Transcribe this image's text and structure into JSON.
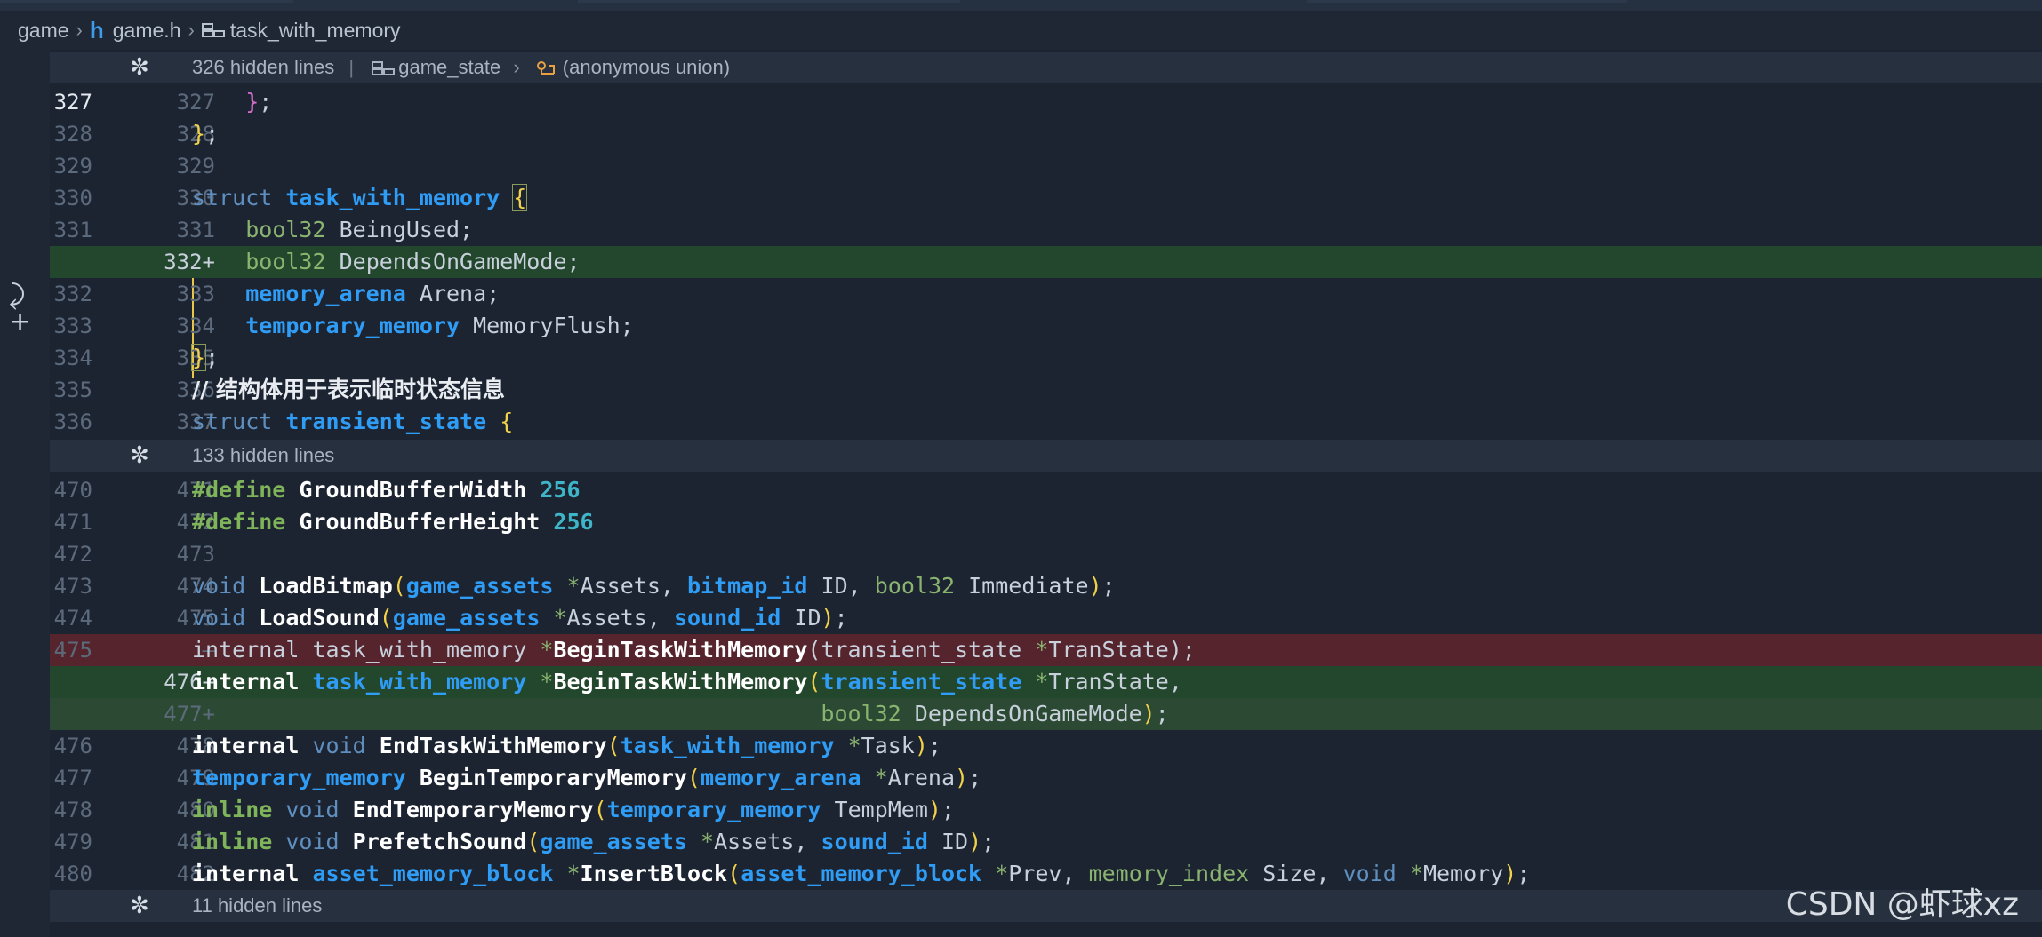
{
  "breadcrumb": {
    "items": [
      "game",
      "game.h",
      "task_with_memory"
    ]
  },
  "fold_sections": [
    {
      "text": "326 hidden lines",
      "scope1": "game_state",
      "scope2": "(anonymous union)"
    },
    {
      "text": "133 hidden lines"
    },
    {
      "text": "11 hidden lines"
    }
  ],
  "lines": {
    "r1": {
      "old": "327",
      "new": "327"
    },
    "r2": {
      "old": "328",
      "new": "328"
    },
    "r3": {
      "old": "329",
      "new": "329"
    },
    "r4": {
      "old": "330",
      "new": "330"
    },
    "r5": {
      "old": "331",
      "new": "331"
    },
    "r6": {
      "old": "",
      "new": "332+"
    },
    "r7": {
      "old": "332",
      "new": "333"
    },
    "r8": {
      "old": "333",
      "new": "334"
    },
    "r9": {
      "old": "334",
      "new": "335"
    },
    "r10": {
      "old": "335",
      "new": "336"
    },
    "r11": {
      "old": "336",
      "new": "337"
    },
    "s1": {
      "old": "470",
      "new": "471"
    },
    "s2": {
      "old": "471",
      "new": "472"
    },
    "s3": {
      "old": "472",
      "new": "473"
    },
    "s4": {
      "old": "473",
      "new": "474"
    },
    "s5": {
      "old": "474",
      "new": "475"
    },
    "s6": {
      "old": "475",
      "new": "—"
    },
    "s7": {
      "old": "",
      "new": "476+"
    },
    "s8": {
      "old": "",
      "new": "477+"
    },
    "s9": {
      "old": "476",
      "new": "478"
    },
    "s10": {
      "old": "477",
      "new": "479"
    },
    "s11": {
      "old": "478",
      "new": "480"
    },
    "s12": {
      "old": "479",
      "new": "481"
    },
    "s13": {
      "old": "480",
      "new": "482"
    }
  },
  "code": {
    "comment": "// 结构体用于表示临时状态信息"
  },
  "watermark": "CSDN @虾球xz",
  "colors": {
    "added": "#23472c",
    "removed": "#55242d",
    "keyword": "#5f8fbf",
    "type": "#2f9cf5"
  }
}
